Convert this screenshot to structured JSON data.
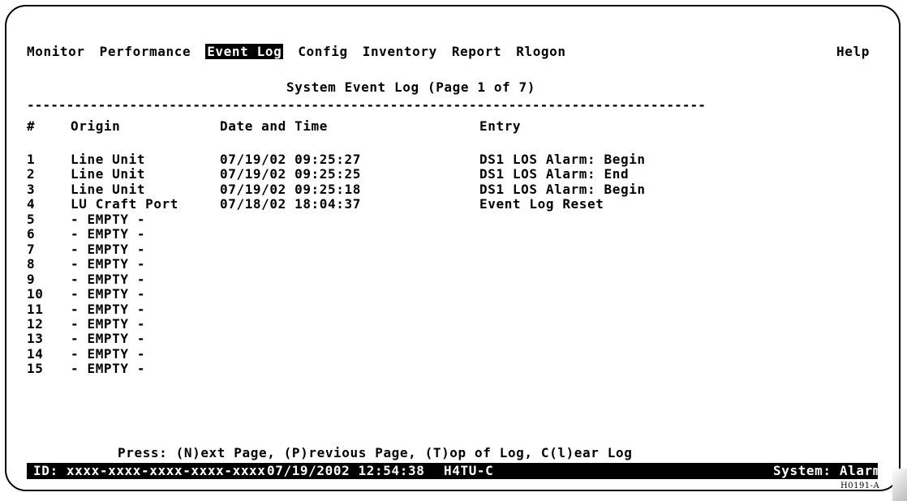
{
  "menu": {
    "items": [
      {
        "label": "Monitor",
        "selected": false
      },
      {
        "label": "Performance",
        "selected": false
      },
      {
        "label": "Event Log",
        "selected": true
      },
      {
        "label": "Config",
        "selected": false
      },
      {
        "label": "Inventory",
        "selected": false
      },
      {
        "label": "Report",
        "selected": false
      },
      {
        "label": "Rlogon",
        "selected": false
      }
    ],
    "help": "Help"
  },
  "page_title": "System Event Log (Page 1 of 7)",
  "rule": "--------------------------------------------------------------------------------------",
  "table": {
    "headers": {
      "num": "#",
      "origin": "Origin",
      "datetime": "Date and Time",
      "entry": "Entry"
    },
    "rows": [
      {
        "num": "1",
        "origin": "Line Unit",
        "datetime": "07/19/02 09:25:27",
        "entry": "DS1 LOS Alarm: Begin"
      },
      {
        "num": "2",
        "origin": "Line Unit",
        "datetime": "07/19/02 09:25:25",
        "entry": "DS1 LOS Alarm: End"
      },
      {
        "num": "3",
        "origin": "Line Unit",
        "datetime": "07/19/02 09:25:18",
        "entry": "DS1 LOS Alarm: Begin"
      },
      {
        "num": "4",
        "origin": "LU Craft Port",
        "datetime": "07/18/02 18:04:37",
        "entry": "Event Log Reset"
      },
      {
        "num": "5",
        "origin": "- EMPTY -",
        "datetime": "",
        "entry": ""
      },
      {
        "num": "6",
        "origin": "- EMPTY -",
        "datetime": "",
        "entry": ""
      },
      {
        "num": "7",
        "origin": "- EMPTY -",
        "datetime": "",
        "entry": ""
      },
      {
        "num": "8",
        "origin": "- EMPTY -",
        "datetime": "",
        "entry": ""
      },
      {
        "num": "9",
        "origin": "- EMPTY -",
        "datetime": "",
        "entry": ""
      },
      {
        "num": "10",
        "origin": "- EMPTY -",
        "datetime": "",
        "entry": ""
      },
      {
        "num": "11",
        "origin": "- EMPTY -",
        "datetime": "",
        "entry": ""
      },
      {
        "num": "12",
        "origin": "- EMPTY -",
        "datetime": "",
        "entry": ""
      },
      {
        "num": "13",
        "origin": "- EMPTY -",
        "datetime": "",
        "entry": ""
      },
      {
        "num": "14",
        "origin": "- EMPTY -",
        "datetime": "",
        "entry": ""
      },
      {
        "num": "15",
        "origin": "- EMPTY -",
        "datetime": "",
        "entry": ""
      }
    ]
  },
  "commands": "Press: (N)ext Page, (P)revious Page, (T)op of Log, C(l)ear Log",
  "status_bar": {
    "id": "ID: xxxx-xxxx-xxxx-xxxx-xxxx",
    "datetime": "07/19/2002 12:54:38",
    "unit": "H4TU-C",
    "system": "System: Alarm"
  },
  "figure_code": "H0191-A"
}
